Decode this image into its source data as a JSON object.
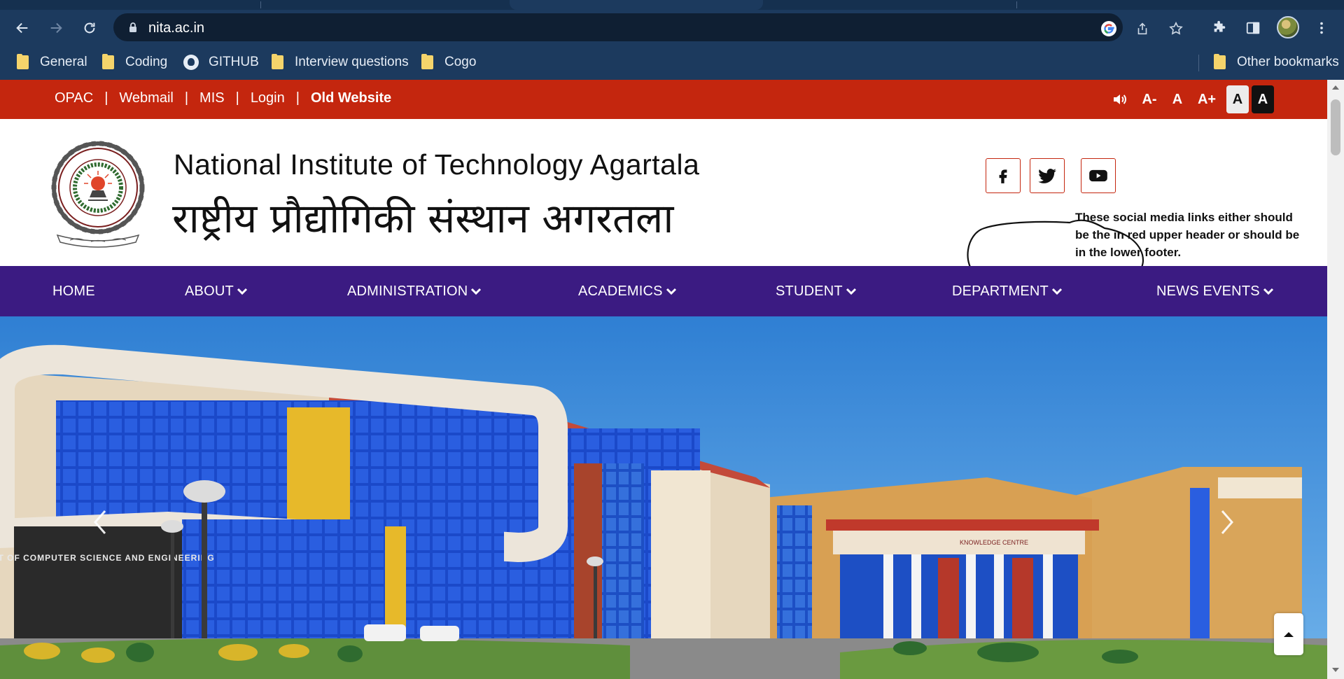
{
  "browser": {
    "url": "nita.ac.in",
    "bookmarks": [
      {
        "label": "General",
        "icon": "folder-icon"
      },
      {
        "label": "Coding",
        "icon": "folder-icon"
      },
      {
        "label": "GITHUB",
        "icon": "github-icon"
      },
      {
        "label": "Interview questions",
        "icon": "folder-icon"
      },
      {
        "label": "Cogo",
        "icon": "folder-icon"
      }
    ],
    "other_bookmarks": "Other bookmarks"
  },
  "topbar": {
    "links": [
      "OPAC",
      "Webmail",
      "MIS",
      "Login"
    ],
    "old_website": "Old Website",
    "separator": "|",
    "accessibility": {
      "decrease": "A-",
      "normal": "A",
      "increase": "A+",
      "light": "A",
      "dark": "A"
    }
  },
  "header": {
    "title_en": "National Institute of Technology Agartala",
    "title_hi": "राष्ट्रीय प्रौद्योगिकी संस्थान अगरतला",
    "social": [
      "facebook-icon",
      "twitter-icon",
      "youtube-icon"
    ],
    "annotation": "These social media links either should be the in red upper header or should be in the lower footer."
  },
  "nav": {
    "items": [
      {
        "label": "HOME",
        "dropdown": false
      },
      {
        "label": "ABOUT",
        "dropdown": true
      },
      {
        "label": "ADMINISTRATION",
        "dropdown": true
      },
      {
        "label": "ACADEMICS",
        "dropdown": true
      },
      {
        "label": "STUDENT",
        "dropdown": true
      },
      {
        "label": "DEPARTMENT",
        "dropdown": true
      },
      {
        "label": "NEWS EVENTS",
        "dropdown": true
      }
    ]
  },
  "hero": {
    "sign_text": "DEPARTMENT OF COMPUTER SCIENCE AND ENGINEERING",
    "building_sign": "KNOWLEDGE CENTRE"
  },
  "colors": {
    "red": "#c4260e",
    "purple": "#3b1b82",
    "chrome": "#1c3a5e"
  }
}
